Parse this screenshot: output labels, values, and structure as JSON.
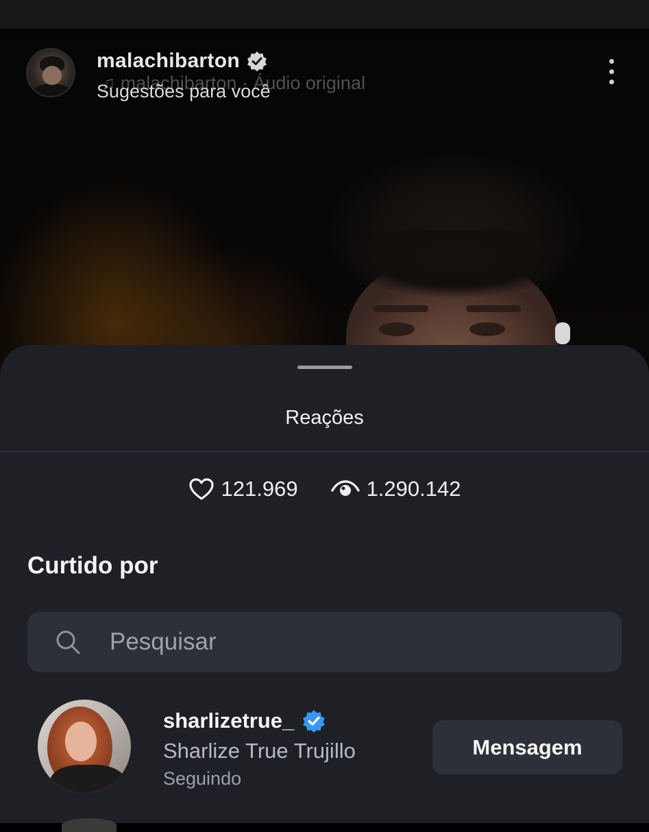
{
  "header": {
    "username": "malachibarton",
    "subtitle": "Sugestões para você",
    "audio": "malachibarton · Áudio original"
  },
  "sheet": {
    "title": "Reações",
    "likes": "121.969",
    "views": "1.290.142",
    "liked_by_heading": "Curtido por",
    "search_placeholder": "Pesquisar"
  },
  "liked_users": [
    {
      "username": "sharlizetrue_",
      "full_name": "Sharlize True Trujillo",
      "status": "Seguindo",
      "button": "Mensagem"
    }
  ],
  "colors": {
    "sheet_bg": "#1e2026",
    "field_bg": "#2d3038",
    "verified_blue": "#3897f0"
  }
}
